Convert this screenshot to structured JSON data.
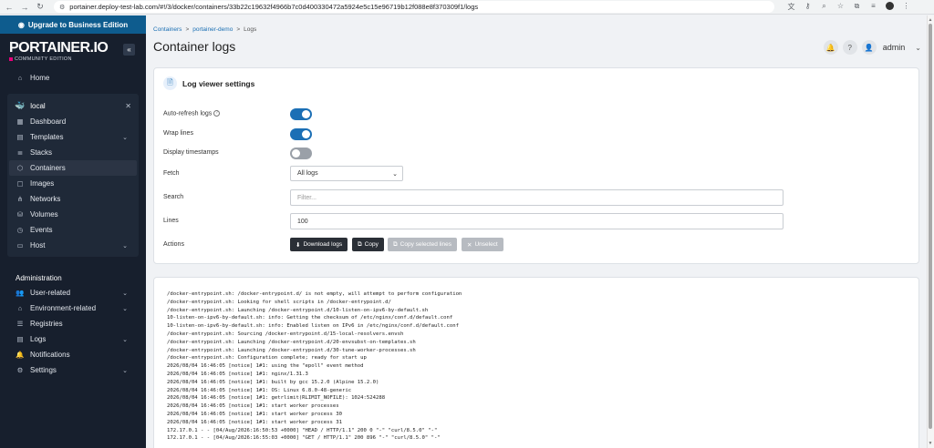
{
  "browser": {
    "url": "portainer.deploy-test-lab.com/#!/3/docker/containers/33b22c19632f4966b7c0d400330472a5924e5c15e96719b12f088e8f370309f1/logs"
  },
  "sidebar": {
    "upgrade_label": "Upgrade to Business Edition",
    "logo_main": "PORTAINER.IO",
    "logo_sub": "COMMUNITY EDITION",
    "collapse_label": "«",
    "home_label": "Home",
    "environment": {
      "name": "local",
      "items": [
        {
          "label": "Dashboard",
          "icon": "dashboard-icon",
          "expandable": false,
          "active": false
        },
        {
          "label": "Templates",
          "icon": "templates-icon",
          "expandable": true,
          "active": false
        },
        {
          "label": "Stacks",
          "icon": "stacks-icon",
          "expandable": false,
          "active": false
        },
        {
          "label": "Containers",
          "icon": "containers-icon",
          "expandable": false,
          "active": true
        },
        {
          "label": "Images",
          "icon": "images-icon",
          "expandable": false,
          "active": false
        },
        {
          "label": "Networks",
          "icon": "networks-icon",
          "expandable": false,
          "active": false
        },
        {
          "label": "Volumes",
          "icon": "volumes-icon",
          "expandable": false,
          "active": false
        },
        {
          "label": "Events",
          "icon": "events-icon",
          "expandable": false,
          "active": false
        },
        {
          "label": "Host",
          "icon": "host-icon",
          "expandable": true,
          "active": false
        }
      ]
    },
    "administration_title": "Administration",
    "admin_items": [
      {
        "label": "User-related",
        "icon": "users-icon",
        "expandable": true
      },
      {
        "label": "Environment-related",
        "icon": "environment-icon",
        "expandable": true
      },
      {
        "label": "Registries",
        "icon": "registries-icon",
        "expandable": false
      },
      {
        "label": "Logs",
        "icon": "logs-icon",
        "expandable": true
      },
      {
        "label": "Notifications",
        "icon": "bell-icon",
        "expandable": false
      },
      {
        "label": "Settings",
        "icon": "gear-icon",
        "expandable": true
      }
    ]
  },
  "header": {
    "breadcrumb": [
      "Containers",
      "portainer-demo",
      "Logs"
    ],
    "title": "Container logs",
    "user": "admin"
  },
  "settings": {
    "title": "Log viewer settings",
    "auto_refresh_label": "Auto-refresh logs",
    "auto_refresh": true,
    "wrap_lines_label": "Wrap lines",
    "wrap_lines": true,
    "timestamps_label": "Display timestamps",
    "timestamps": false,
    "fetch_label": "Fetch",
    "fetch_value": "All logs",
    "search_label": "Search",
    "search_placeholder": "Filter...",
    "lines_label": "Lines",
    "lines_value": "100",
    "actions_label": "Actions",
    "download_label": "Download logs",
    "copy_label": "Copy",
    "copy_selected_label": "Copy selected lines",
    "unselect_label": "Unselect"
  },
  "logs": [
    "/docker-entrypoint.sh: /docker-entrypoint.d/ is not empty, will attempt to perform configuration",
    "/docker-entrypoint.sh: Looking for shell scripts in /docker-entrypoint.d/",
    "/docker-entrypoint.sh: Launching /docker-entrypoint.d/10-listen-on-ipv6-by-default.sh",
    "10-listen-on-ipv6-by-default.sh: info: Getting the checksum of /etc/nginx/conf.d/default.conf",
    "10-listen-on-ipv6-by-default.sh: info: Enabled listen on IPv6 in /etc/nginx/conf.d/default.conf",
    "/docker-entrypoint.sh: Sourcing /docker-entrypoint.d/15-local-resolvers.envsh",
    "/docker-entrypoint.sh: Launching /docker-entrypoint.d/20-envsubst-on-templates.sh",
    "/docker-entrypoint.sh: Launching /docker-entrypoint.d/30-tune-worker-processes.sh",
    "/docker-entrypoint.sh: Configuration complete; ready for start up",
    "2026/08/04 16:46:05 [notice] 1#1: using the \"epoll\" event method",
    "2026/08/04 16:46:05 [notice] 1#1: nginx/1.31.3",
    "2026/08/04 16:46:05 [notice] 1#1: built by gcc 15.2.0 (Alpine 15.2.0)",
    "2026/08/04 16:46:05 [notice] 1#1: OS: Linux 6.8.0-48-generic",
    "2026/08/04 16:46:05 [notice] 1#1: getrlimit(RLIMIT_NOFILE): 1024:524288",
    "2026/08/04 16:46:05 [notice] 1#1: start worker processes",
    "2026/08/04 16:46:05 [notice] 1#1: start worker process 30",
    "2026/08/04 16:46:05 [notice] 1#1: start worker process 31",
    "172.17.0.1 - - [04/Aug/2026:16:50:53 +0000] \"HEAD / HTTP/1.1\" 200 0 \"-\" \"curl/8.5.0\" \"-\"",
    "172.17.0.1 - - [04/Aug/2026:16:55:03 +0000] \"GET / HTTP/1.1\" 200 896 \"-\" \"curl/8.5.0\" \"-\""
  ],
  "colors": {
    "sidebar_bg": "#171f2d",
    "upgrade_bg": "#0e5c8e",
    "toggle_on": "#1b6fb5",
    "button_dark": "#2a2f36"
  }
}
